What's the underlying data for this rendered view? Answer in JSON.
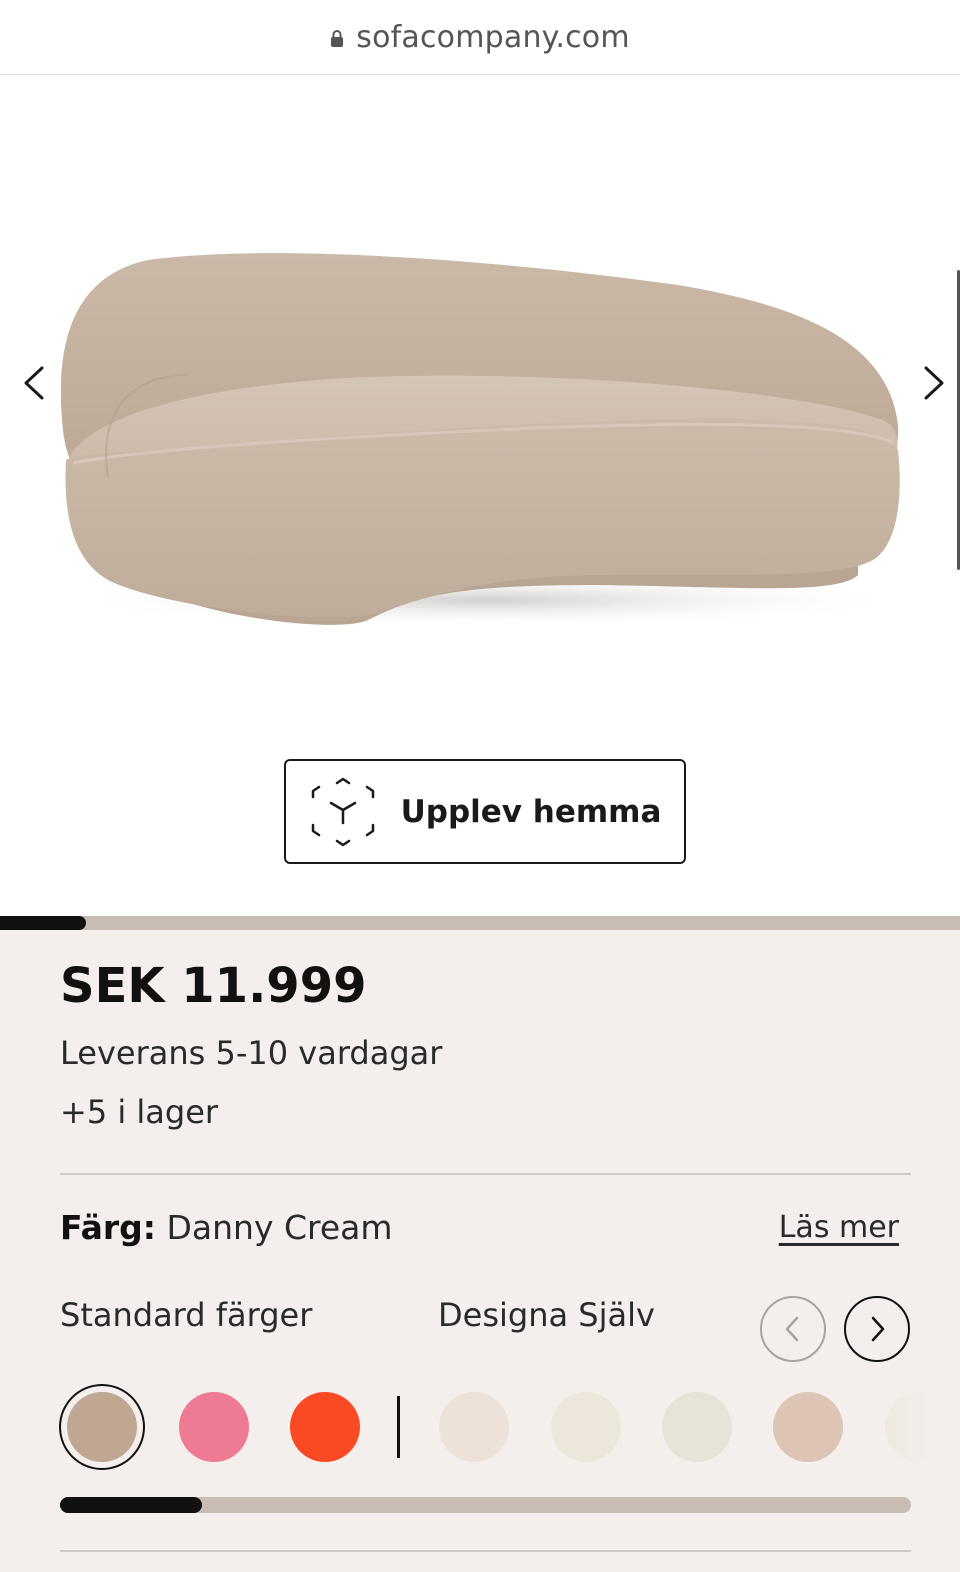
{
  "browser": {
    "domain": "sofacompany.com",
    "lock_icon": "lock-icon"
  },
  "gallery": {
    "prev_icon": "chevron-left-icon",
    "next_icon": "chevron-right-icon",
    "ar_button_label": "Upplev hemma",
    "ar_icon": "ar-cube-icon",
    "progress": 0.09
  },
  "product": {
    "price": "SEK 11.999",
    "delivery": "Leverans 5-10 vardagar",
    "stock": "+5  i lager"
  },
  "color": {
    "label": "Färg:",
    "value": "Danny Cream",
    "read_more": "Läs mer",
    "tabs": {
      "standard": "Standard färger",
      "custom": "Designa Själv"
    },
    "standard_swatches": [
      "#c0a792",
      "#ee7b93",
      "#fa4a24"
    ],
    "custom_swatches": [
      "#ece2d9",
      "#ede6da",
      "#e8e3d9",
      "#dcc5b4"
    ],
    "selected_index": 0,
    "progress": 0.167
  }
}
